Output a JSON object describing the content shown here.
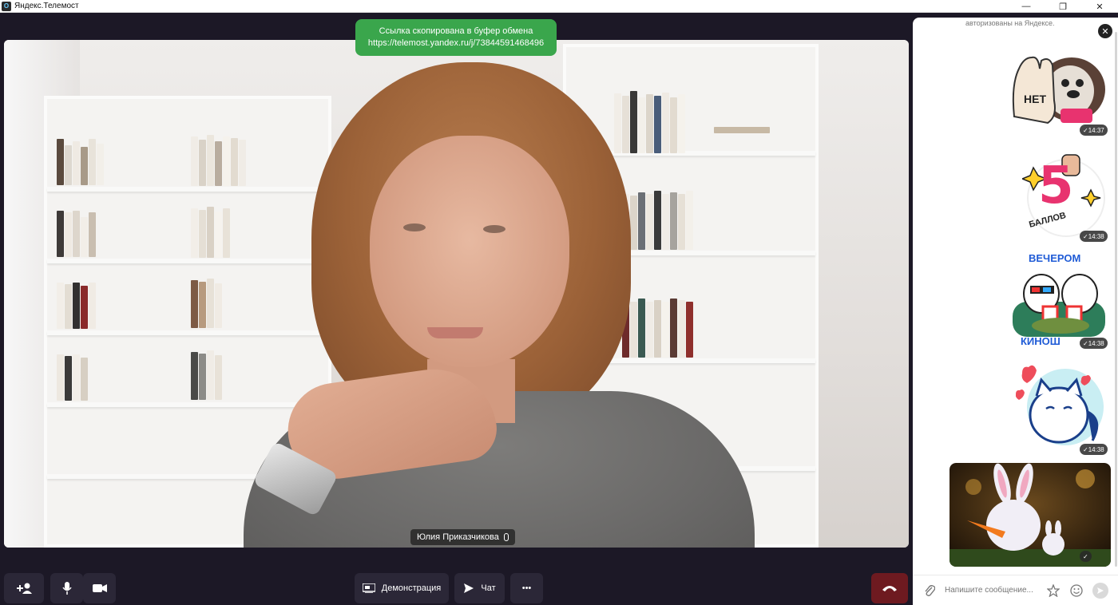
{
  "window": {
    "app_icon": "О",
    "title": "Яндекс.Телемост",
    "minimize": "—",
    "restore": "❐",
    "close": "✕"
  },
  "toast": {
    "line1": "Ссылка скопирована в буфер обмена",
    "line2": "https://telemost.yandex.ru/j/73844591468496",
    "color": "#3aa64c"
  },
  "video": {
    "participant_name": "Юлия Приказчикова"
  },
  "toolbar": {
    "demo_label": "Демонстрация",
    "chat_label": "Чат",
    "more_label": "•••"
  },
  "chat": {
    "note": "авторизованы на Яндексе.",
    "messages": [
      {
        "sticker_text": "НЕТ",
        "time": "✓14:37"
      },
      {
        "sticker_text": "5",
        "sticker_caption": "БАЛЛОВ",
        "time": "✓14:38"
      },
      {
        "sticker_text": "ВЕЧЕРОМ",
        "sticker_caption": "КИНОШ",
        "time": "✓14:38"
      },
      {
        "time": "✓14:38"
      },
      {
        "time": "✓"
      }
    ],
    "input_placeholder": "Напишите сообщение...",
    "accent": "#ffffff"
  }
}
